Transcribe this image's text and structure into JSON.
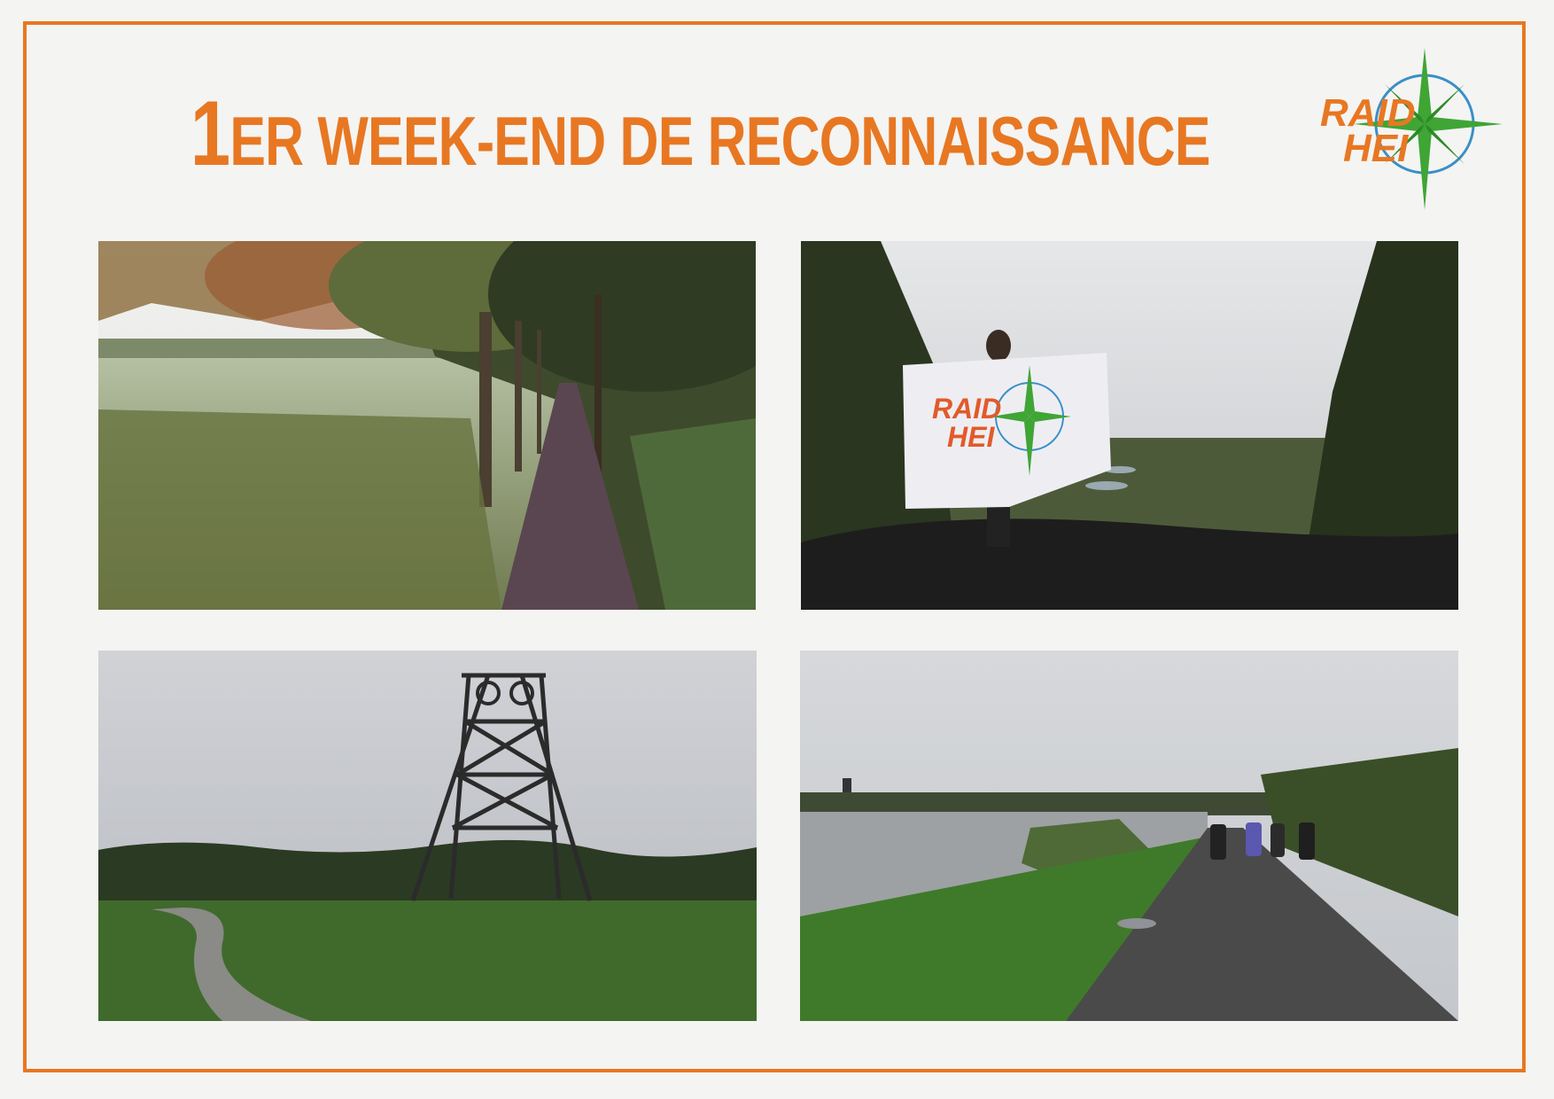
{
  "page": {
    "title_first": "1",
    "title_rest": "ER WEEK-END DE RECONNAISSANCE"
  },
  "logo": {
    "line1": "RAID",
    "line2": "HEI",
    "icon": "compass-rose-icon"
  },
  "photos": [
    {
      "name": "forest-path-photo"
    },
    {
      "name": "flag-on-hill-photo",
      "flag_line1": "RAID",
      "flag_line2": "HEI"
    },
    {
      "name": "mine-headframe-photo"
    },
    {
      "name": "lake-walkers-photo"
    }
  ],
  "colors": {
    "accent": "#e87722",
    "logo_green": "#3fa535",
    "logo_blue": "#3a8fc9",
    "background": "#f4f4f2"
  }
}
